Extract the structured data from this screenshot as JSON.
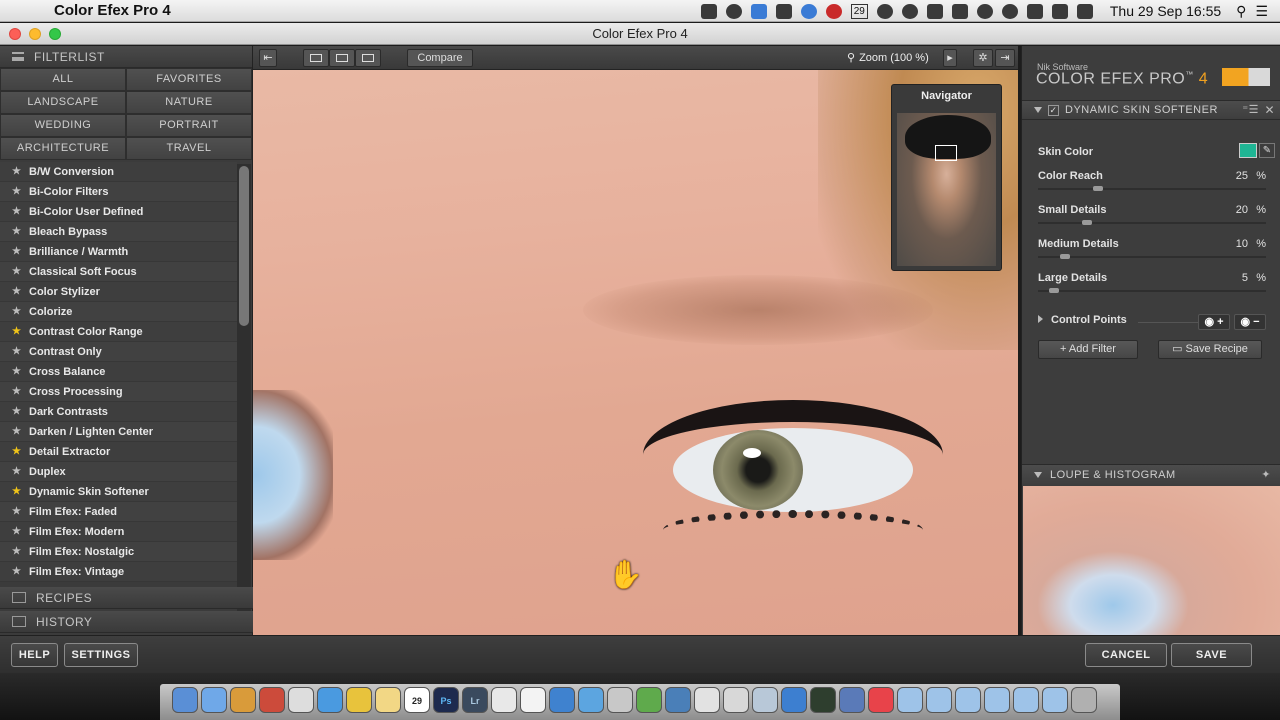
{
  "menubar": {
    "app_name": "Color Efex Pro 4",
    "calendar_day": "29",
    "clock": "Thu 29 Sep  16:55"
  },
  "window": {
    "title": "Color Efex Pro 4"
  },
  "left_panel": {
    "filterlist_title": "FILTERLIST",
    "categories": [
      "ALL",
      "FAVORITES",
      "LANDSCAPE",
      "NATURE",
      "WEDDING",
      "PORTRAIT",
      "ARCHITECTURE",
      "TRAVEL"
    ],
    "filters": [
      {
        "name": "B/W Conversion",
        "favorite": false
      },
      {
        "name": "Bi-Color Filters",
        "favorite": false
      },
      {
        "name": "Bi-Color User Defined",
        "favorite": false
      },
      {
        "name": "Bleach Bypass",
        "favorite": false
      },
      {
        "name": "Brilliance / Warmth",
        "favorite": false
      },
      {
        "name": "Classical Soft Focus",
        "favorite": false
      },
      {
        "name": "Color Stylizer",
        "favorite": false
      },
      {
        "name": "Colorize",
        "favorite": false
      },
      {
        "name": "Contrast Color Range",
        "favorite": true
      },
      {
        "name": "Contrast Only",
        "favorite": false
      },
      {
        "name": "Cross Balance",
        "favorite": false
      },
      {
        "name": "Cross Processing",
        "favorite": false
      },
      {
        "name": "Dark Contrasts",
        "favorite": false
      },
      {
        "name": "Darken / Lighten Center",
        "favorite": false
      },
      {
        "name": "Detail Extractor",
        "favorite": true
      },
      {
        "name": "Duplex",
        "favorite": false
      },
      {
        "name": "Dynamic Skin Softener",
        "favorite": true
      },
      {
        "name": "Film Efex: Faded",
        "favorite": false
      },
      {
        "name": "Film Efex: Modern",
        "favorite": false
      },
      {
        "name": "Film Efex: Nostalgic",
        "favorite": false
      },
      {
        "name": "Film Efex: Vintage",
        "favorite": false
      }
    ],
    "recipes_title": "RECIPES",
    "history_title": "HISTORY"
  },
  "toolbar": {
    "compare_label": "Compare",
    "zoom_label": "Zoom (100 %)"
  },
  "navigator": {
    "title": "Navigator"
  },
  "right_panel": {
    "brand_small": "Nik Software",
    "brand": "COLOR EFEX PRO",
    "brand_tm": "™",
    "brand_version": "4",
    "filter_title": "DYNAMIC SKIN SOFTENER",
    "skin_color_label": "Skin Color",
    "skin_color": "#1fb594",
    "params": [
      {
        "label": "Color Reach",
        "value": "25",
        "unit": "%",
        "level": 0.25
      },
      {
        "label": "Small Details",
        "value": "20",
        "unit": "%",
        "level": 0.2
      },
      {
        "label": "Medium Details",
        "value": "10",
        "unit": "%",
        "level": 0.1
      },
      {
        "label": "Large Details",
        "value": "5",
        "unit": "%",
        "level": 0.05
      }
    ],
    "control_points_label": "Control Points",
    "add_filter_label": "Add Filter",
    "save_recipe_label": "Save Recipe",
    "loupe_title": "LOUPE & HISTOGRAM"
  },
  "bottom_bar": {
    "help_label": "HELP",
    "settings_label": "SETTINGS",
    "cancel_label": "CANCEL",
    "save_label": "SAVE"
  },
  "dock": {
    "calendar_day": "29",
    "ps_label": "Ps",
    "lr_label": "Lr"
  }
}
